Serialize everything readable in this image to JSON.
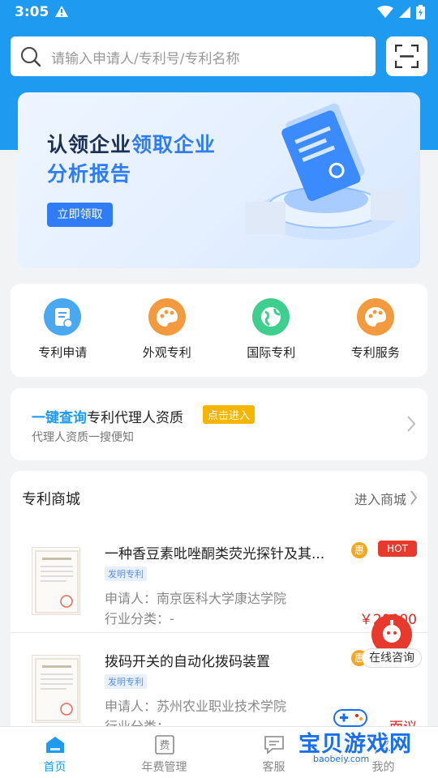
{
  "status": {
    "time": "3:05"
  },
  "search": {
    "placeholder": "请输入申请人/专利号/专利名称"
  },
  "banner": {
    "title_part1": "认领企业",
    "title_part2": "领取企业",
    "title_line2": "分析报告",
    "button": "立即领取"
  },
  "services": [
    {
      "label": "专利申请",
      "icon": "patent-apply-icon",
      "color": "#4aa8f0"
    },
    {
      "label": "外观专利",
      "icon": "palette-icon",
      "color": "#f49a3e"
    },
    {
      "label": "国际专利",
      "icon": "globe-icon",
      "color": "#3ecf8e"
    },
    {
      "label": "专利服务",
      "icon": "palette-icon",
      "color": "#f49a3e"
    }
  ],
  "agent": {
    "highlight": "一键查询",
    "text": "专利代理人资质",
    "tag": "点击进入",
    "subtitle": "代理人资质一搜便知"
  },
  "mall": {
    "title": "专利商城",
    "more": "进入商城",
    "products": [
      {
        "name": "一种香豆素吡唑酮类荧光探针及其...",
        "type": "发明专利",
        "applicant": "申请人：南京医科大学康达学院",
        "industry": "行业分类：-",
        "badge": "惠",
        "hot": "HOT",
        "price": "￥20000"
      },
      {
        "name": "拨码开关的自动化拨码装置",
        "type": "发明专利",
        "applicant": "申请人：苏州农业职业技术学院",
        "industry": "行业分类：-",
        "badge": "惠",
        "price_text": "面议"
      }
    ]
  },
  "consult": {
    "label": "在线咨询"
  },
  "nav": [
    {
      "label": "首页",
      "active": true
    },
    {
      "label": "年费管理",
      "icon_text": "费"
    },
    {
      "label": "客服"
    },
    {
      "label": "我的"
    }
  ],
  "watermark": {
    "text": "宝贝游戏网",
    "url": "baobeiy.com"
  },
  "colors": {
    "primary": "#1e9bf0",
    "price": "#e1251b",
    "tag": "#f7b500"
  }
}
